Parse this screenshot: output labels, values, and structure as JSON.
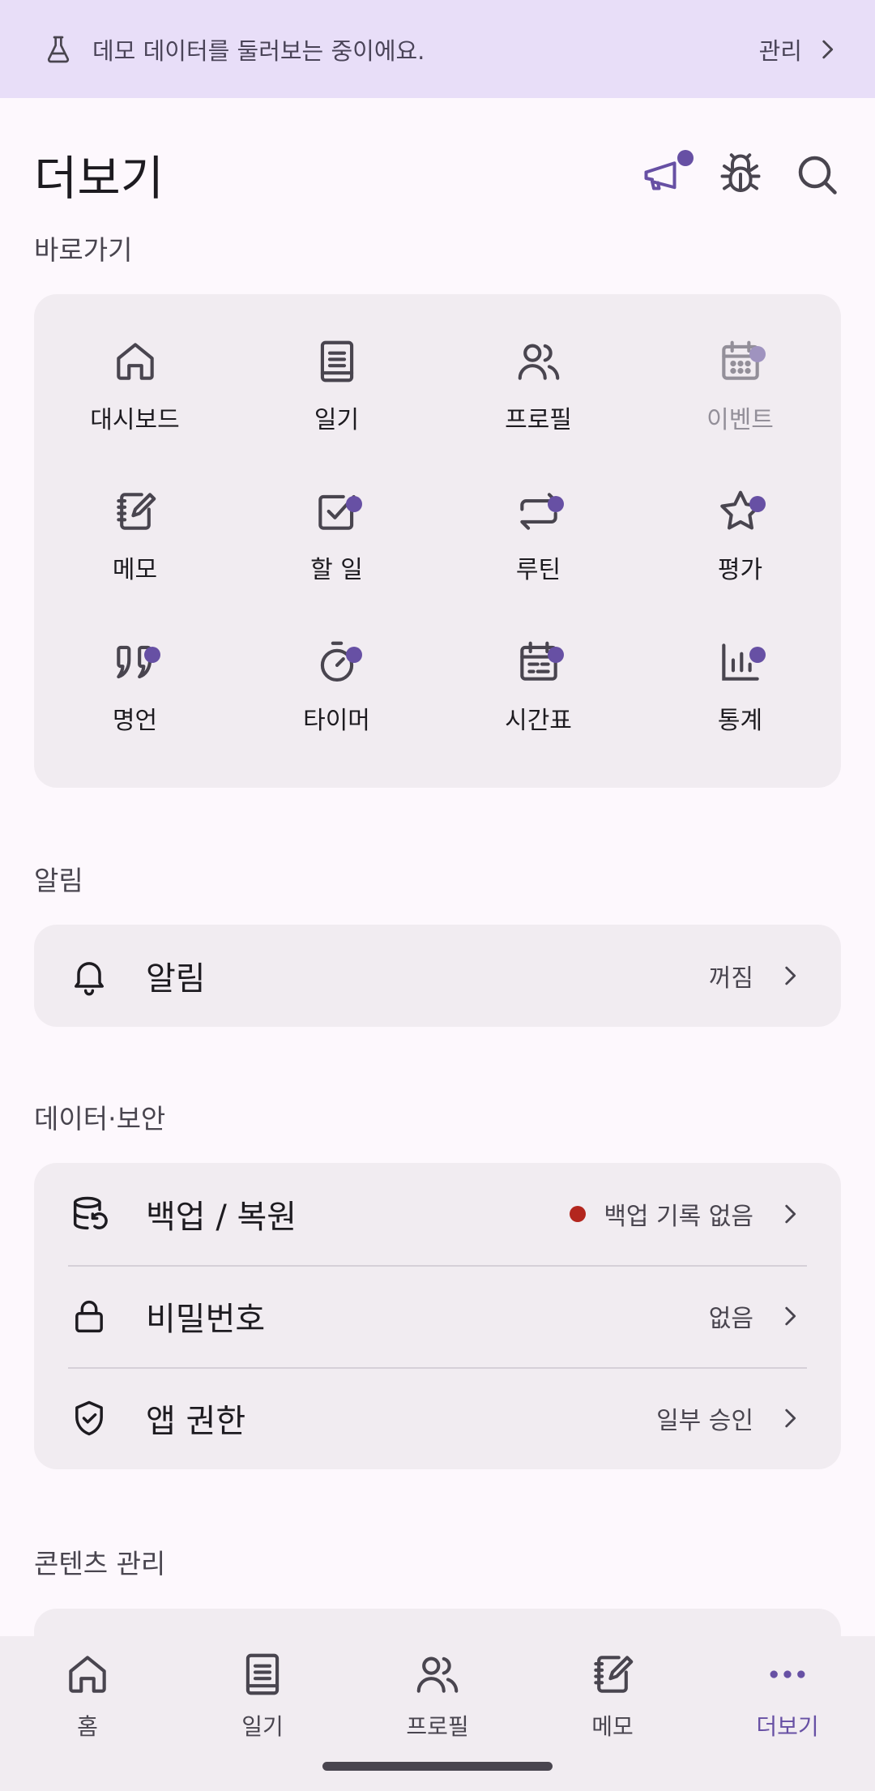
{
  "banner": {
    "text": "데모 데이터를 둘러보는 중이에요.",
    "action_label": "관리",
    "icon": "flask-icon"
  },
  "header": {
    "title": "더보기",
    "actions": [
      "megaphone-icon",
      "bug-icon",
      "search-icon"
    ]
  },
  "shortcuts": {
    "label": "바로가기",
    "items": [
      {
        "label": "대시보드",
        "icon": "home-icon"
      },
      {
        "label": "일기",
        "icon": "book-icon"
      },
      {
        "label": "프로필",
        "icon": "people-icon"
      },
      {
        "label": "이벤트",
        "icon": "calendar-icon"
      },
      {
        "label": "메모",
        "icon": "note-icon"
      },
      {
        "label": "할 일",
        "icon": "checkbox-icon"
      },
      {
        "label": "루틴",
        "icon": "repeat-icon"
      },
      {
        "label": "평가",
        "icon": "star-icon"
      },
      {
        "label": "명언",
        "icon": "quote-icon"
      },
      {
        "label": "타이머",
        "icon": "timer-icon"
      },
      {
        "label": "시간표",
        "icon": "timetable-icon"
      },
      {
        "label": "통계",
        "icon": "stats-icon"
      }
    ]
  },
  "notifications": {
    "label": "알림",
    "rows": [
      {
        "label": "알림",
        "value": "꺼짐",
        "icon": "bell-icon"
      }
    ]
  },
  "data_security": {
    "label": "데이터·보안",
    "rows": [
      {
        "label": "백업 / 복원",
        "value": "백업 기록 없음",
        "icon": "database-restore-icon"
      },
      {
        "label": "비밀번호",
        "value": "없음",
        "icon": "lock-icon"
      },
      {
        "label": "앱 권한",
        "value": "일부 승인",
        "icon": "shield-check-icon"
      }
    ]
  },
  "content_management": {
    "label": "콘텐츠 관리"
  },
  "bottom_nav": {
    "items": [
      {
        "label": "홈",
        "icon": "home-icon"
      },
      {
        "label": "일기",
        "icon": "book-icon"
      },
      {
        "label": "프로필",
        "icon": "people-icon"
      },
      {
        "label": "메모",
        "icon": "note-icon"
      },
      {
        "label": "더보기",
        "icon": "more-icon"
      }
    ],
    "active": "더보기"
  },
  "colors": {
    "accent": "#6750a4",
    "banner_bg": "#e8def8",
    "card_bg": "#f1ecf1",
    "status_red": "#b3261e"
  }
}
